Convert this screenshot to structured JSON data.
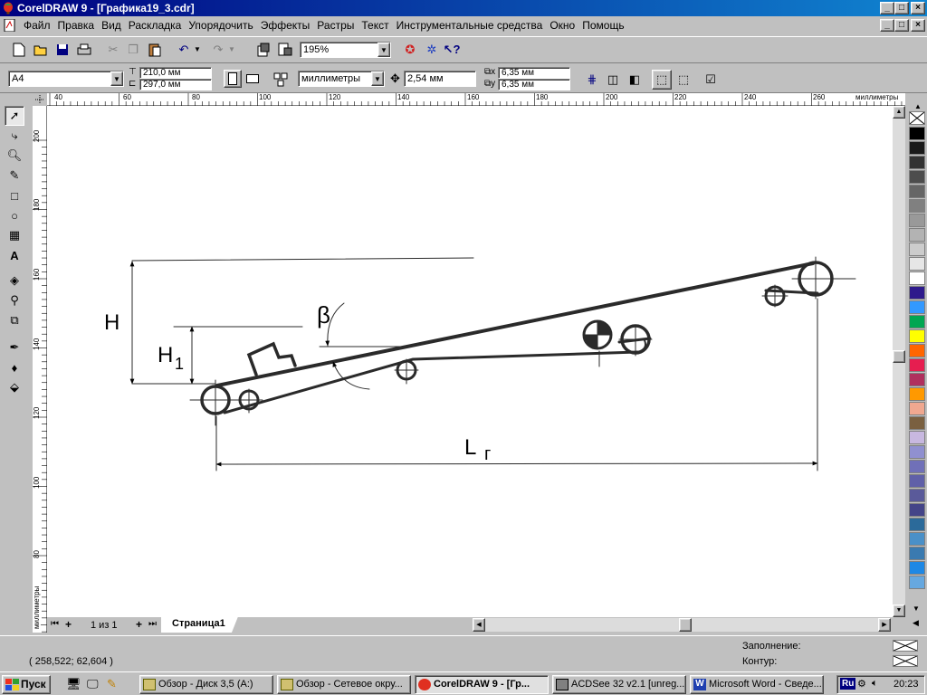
{
  "window": {
    "title": "CorelDRAW 9 - [Графика19_3.cdr]"
  },
  "menu": [
    "Файл",
    "Правка",
    "Вид",
    "Раскладка",
    "Упорядочить",
    "Эффекты",
    "Растры",
    "Текст",
    "Инструментальные средства",
    "Окно",
    "Помощь"
  ],
  "toolbar": {
    "zoom": "195%"
  },
  "property_bar": {
    "paper": "A4",
    "width": "210,0 мм",
    "height": "297,0 мм",
    "units": "миллиметры",
    "nudge": "2,54 мм",
    "dup_x": "6,35 мм",
    "dup_y": "6,35 мм"
  },
  "rulers": {
    "h_ticks": [
      "40",
      "60",
      "80",
      "100",
      "120",
      "140",
      "160",
      "180",
      "200",
      "220",
      "240",
      "260"
    ],
    "h_unit": "миллиметры",
    "v_ticks": [
      "200",
      "180",
      "160",
      "140",
      "120",
      "100",
      "80"
    ],
    "v_unit": "миллиметры"
  },
  "drawing": {
    "label_H": "H",
    "label_H1": "H",
    "label_H1_sub": "1",
    "label_beta": "β",
    "label_L": "L",
    "label_L_sub": "г"
  },
  "page_nav": {
    "counter": "1 из 1",
    "page_tab": "Страница1"
  },
  "status": {
    "coords": "( 258,522; 62,604 )",
    "fill_label": "Заполнение:",
    "outline_label": "Контур:"
  },
  "palette": [
    "#000000",
    "#1a1a1a",
    "#333333",
    "#4d4d4d",
    "#666666",
    "#808080",
    "#999999",
    "#b3b3b3",
    "#cccccc",
    "#e6e6e6",
    "#ffffff",
    "#2e1a8c",
    "#3399ff",
    "#00a651",
    "#ffff00",
    "#ff6600",
    "#e61e50",
    "#b0305e",
    "#ff9900",
    "#f0a890",
    "#7a6040",
    "#c8b8e0",
    "#9090d0",
    "#7070b8",
    "#6060a8",
    "#5a5a9a",
    "#444488",
    "#2b6a9a",
    "#4a90c8",
    "#3a7ab0",
    "#1e88e5",
    "#66a8e0"
  ],
  "taskbar": {
    "start": "Пуск",
    "tasks": [
      "Обзор - Диск 3,5 (A:)",
      "Обзор - Сетевое окру...",
      "CorelDRAW 9 - [Гр...",
      "ACDSee 32 v2.1  [unreg...",
      "Microsoft Word - Сведе..."
    ],
    "lang": "Ru",
    "clock": "20:23"
  }
}
